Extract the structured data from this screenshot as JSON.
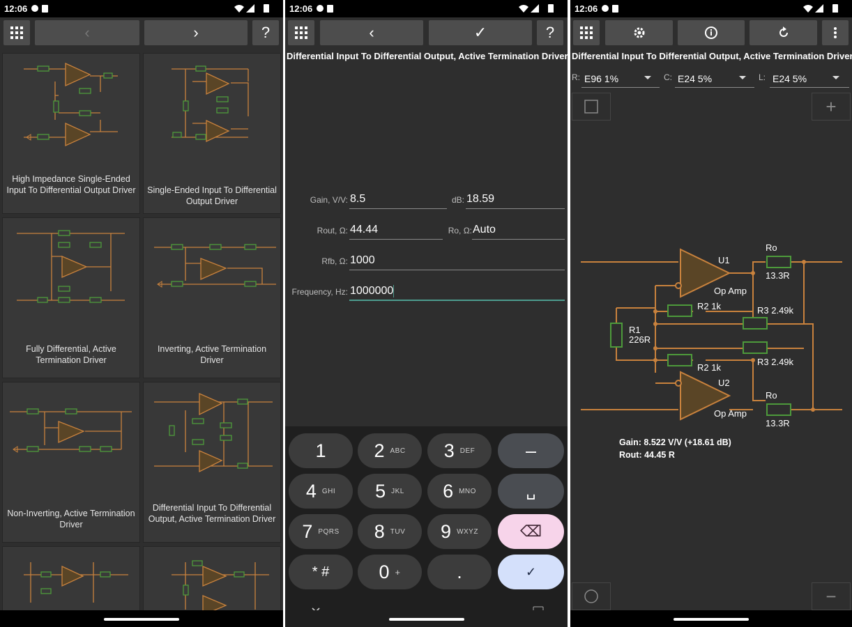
{
  "status": {
    "time": "12:06"
  },
  "panel1": {
    "toolbar": {
      "grid_icon": "grid-icon",
      "back": "‹",
      "forward": "›",
      "help": "?"
    },
    "items": [
      {
        "label": "High Impedance Single-Ended Input To Differential Output Driver"
      },
      {
        "label": "Single-Ended Input To Differential Output Driver"
      },
      {
        "label": "Fully Differential, Active Termination Driver"
      },
      {
        "label": "Inverting, Active Termination Driver"
      },
      {
        "label": "Non-Inverting, Active Termination Driver"
      },
      {
        "label": "Differential Input To Differential Output, Active Termination Driver"
      }
    ]
  },
  "panel2": {
    "title": "Differential Input To Differential Output, Active Termination Driver",
    "toolbar": {
      "back": "‹",
      "ok": "✓",
      "help": "?"
    },
    "fields": {
      "gain_label": "Gain, V/V:",
      "gain_value": "8.5",
      "db_label": "dB:",
      "db_value": "18.59",
      "rout_label": "Rout, Ω:",
      "rout_value": "44.44",
      "ro_label": "Ro, Ω:",
      "ro_value": "Auto",
      "rfb_label": "Rfb, Ω:",
      "rfb_value": "1000",
      "freq_label": "Frequency, Hz:",
      "freq_value": "1000000"
    },
    "keys": [
      {
        "main": "1",
        "sub": ""
      },
      {
        "main": "2",
        "sub": "ABC"
      },
      {
        "main": "3",
        "sub": "DEF"
      },
      {
        "main": "–",
        "sub": ""
      },
      {
        "main": "4",
        "sub": "GHI"
      },
      {
        "main": "5",
        "sub": "JKL"
      },
      {
        "main": "6",
        "sub": "MNO"
      },
      {
        "main": "␣",
        "sub": ""
      },
      {
        "main": "7",
        "sub": "PQRS"
      },
      {
        "main": "8",
        "sub": "TUV"
      },
      {
        "main": "9",
        "sub": "WXYZ"
      },
      {
        "main": "⌫",
        "sub": ""
      },
      {
        "main": "* #",
        "sub": ""
      },
      {
        "main": "0",
        "sub": "+"
      },
      {
        "main": ".",
        "sub": ""
      },
      {
        "main": "✓",
        "sub": ""
      }
    ]
  },
  "panel3": {
    "title": "Differential Input To Differential Output, Active Termination Driver",
    "combos": {
      "r_label": "R:",
      "r_value": "E96 1%",
      "c_label": "C:",
      "c_value": "E24 5%",
      "l_label": "L:",
      "l_value": "E24 5%"
    },
    "schematic": {
      "u1": "U1",
      "u1_type": "Op Amp",
      "u2": "U2",
      "u2_type": "Op Amp",
      "ro_top": "Ro",
      "ro_top_val": "13.3R",
      "ro_bot": "Ro",
      "ro_bot_val": "13.3R",
      "r1": "R1",
      "r1_val": "226R",
      "r2_top": "R2 1k",
      "r2_bot": "R2 1k",
      "r3_top": "R3 2.49k",
      "r3_bot": "R3 2.49k"
    },
    "result": {
      "gain": "Gain: 8.522 V/V (+18.61 dB)",
      "rout": "Rout: 44.45 R"
    }
  }
}
